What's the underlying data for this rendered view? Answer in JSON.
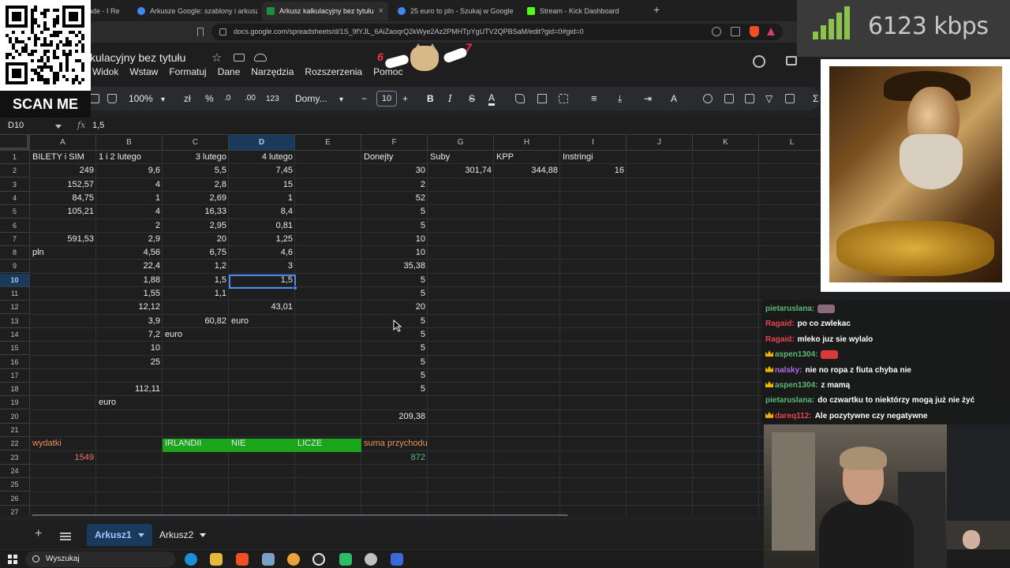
{
  "browser": {
    "tabs": [
      {
        "label": "ade - I Re",
        "favicon": "#d93025"
      },
      {
        "label": "Arkusze Google: szablony i arkusze i",
        "favicon": "#4285f4"
      },
      {
        "label": "Arkusz kalkulacyjny bez tytułu - G",
        "favicon": "#1e8e3e"
      },
      {
        "label": "25 euro to pln - Szukaj w Google",
        "favicon": "#4285f4"
      },
      {
        "label": "Stream - Kick Dashboard",
        "favicon": "#53fc18"
      }
    ],
    "active_tab": 2,
    "new_tab_label": "+",
    "url": "docs.google.com/spreadsheets/d/1S_9fYJL_6AiZaoqrQ2kWye2Az2PMHTpYgUTV2QPBSaM/edit?gid=0#gid=0"
  },
  "sheets": {
    "title": "kulacyjny bez tytułu",
    "menu": [
      "Widok",
      "Wstaw",
      "Formatuj",
      "Dane",
      "Narzędzia",
      "Rozszerzenia",
      "Pomoc"
    ],
    "toolbar": {
      "zoom": "100%",
      "currency": "zł",
      "percent": "%",
      "dec_less": ".0",
      "dec_more": ".00",
      "number_fmt": "123",
      "font": "Domy...",
      "minus": "−",
      "font_size": "10",
      "plus": "+",
      "bold": "B",
      "italic": "I",
      "strike": "S",
      "text_color": "A",
      "sigma": "Σ"
    },
    "name_box": "D10",
    "fx_label": "fx",
    "formula": "1,5",
    "columns": [
      "A",
      "B",
      "C",
      "D",
      "E",
      "F",
      "G",
      "H",
      "I",
      "J",
      "K",
      "L"
    ],
    "selected_column": "D",
    "selected_row": 10,
    "rows": [
      "1",
      "2",
      "3",
      "4",
      "5",
      "6",
      "7",
      "8",
      "9",
      "10",
      "11",
      "12",
      "13",
      "14",
      "15",
      "16",
      "17",
      "18",
      "19",
      "20",
      "21",
      "22",
      "23",
      "24",
      "25",
      "26",
      "27"
    ],
    "cells": [
      {
        "ref": "A1",
        "v": "BILETY i SIM"
      },
      {
        "ref": "B1",
        "v": "1 i 2 lutego"
      },
      {
        "ref": "C1",
        "v": "3 lutego",
        "align": "r"
      },
      {
        "ref": "D1",
        "v": "4 lutego",
        "align": "r"
      },
      {
        "ref": "F1",
        "v": "Donejty"
      },
      {
        "ref": "G1",
        "v": "Suby"
      },
      {
        "ref": "H1",
        "v": "KPP"
      },
      {
        "ref": "I1",
        "v": "Instringi"
      },
      {
        "ref": "A2",
        "v": "249",
        "align": "r"
      },
      {
        "ref": "B2",
        "v": "9,6",
        "align": "r"
      },
      {
        "ref": "C2",
        "v": "5,5",
        "align": "r"
      },
      {
        "ref": "D2",
        "v": "7,45",
        "align": "r"
      },
      {
        "ref": "F2",
        "v": "30",
        "align": "r"
      },
      {
        "ref": "G2",
        "v": "301,74",
        "align": "r"
      },
      {
        "ref": "H2",
        "v": "344,88",
        "align": "r"
      },
      {
        "ref": "I2",
        "v": "16",
        "align": "r"
      },
      {
        "ref": "A3",
        "v": "152,57",
        "align": "r"
      },
      {
        "ref": "B3",
        "v": "4",
        "align": "r"
      },
      {
        "ref": "C3",
        "v": "2,8",
        "align": "r"
      },
      {
        "ref": "D3",
        "v": "15",
        "align": "r"
      },
      {
        "ref": "F3",
        "v": "2",
        "align": "r"
      },
      {
        "ref": "A4",
        "v": "84,75",
        "align": "r"
      },
      {
        "ref": "B4",
        "v": "1",
        "align": "r"
      },
      {
        "ref": "C4",
        "v": "2,69",
        "align": "r"
      },
      {
        "ref": "D4",
        "v": "1",
        "align": "r"
      },
      {
        "ref": "F4",
        "v": "52",
        "align": "r"
      },
      {
        "ref": "A5",
        "v": "105,21",
        "align": "r"
      },
      {
        "ref": "B5",
        "v": "4",
        "align": "r"
      },
      {
        "ref": "C5",
        "v": "16,33",
        "align": "r"
      },
      {
        "ref": "D5",
        "v": "8,4",
        "align": "r"
      },
      {
        "ref": "F5",
        "v": "5",
        "align": "r"
      },
      {
        "ref": "B6",
        "v": "2",
        "align": "r"
      },
      {
        "ref": "C6",
        "v": "2,95",
        "align": "r"
      },
      {
        "ref": "D6",
        "v": "0,81",
        "align": "r"
      },
      {
        "ref": "F6",
        "v": "5",
        "align": "r"
      },
      {
        "ref": "A7",
        "v": "591,53",
        "align": "r"
      },
      {
        "ref": "B7",
        "v": "2,9",
        "align": "r"
      },
      {
        "ref": "C7",
        "v": "20",
        "align": "r"
      },
      {
        "ref": "D7",
        "v": "1,25",
        "align": "r"
      },
      {
        "ref": "F7",
        "v": "10",
        "align": "r"
      },
      {
        "ref": "A8",
        "v": "pln"
      },
      {
        "ref": "B8",
        "v": "4,56",
        "align": "r"
      },
      {
        "ref": "C8",
        "v": "6,75",
        "align": "r"
      },
      {
        "ref": "D8",
        "v": "4,6",
        "align": "r"
      },
      {
        "ref": "F8",
        "v": "10",
        "align": "r"
      },
      {
        "ref": "B9",
        "v": "22,4",
        "align": "r"
      },
      {
        "ref": "C9",
        "v": "1,2",
        "align": "r"
      },
      {
        "ref": "D9",
        "v": "3",
        "align": "r"
      },
      {
        "ref": "F9",
        "v": "35,38",
        "align": "r"
      },
      {
        "ref": "B10",
        "v": "1,88",
        "align": "r"
      },
      {
        "ref": "C10",
        "v": "1,5",
        "align": "r"
      },
      {
        "ref": "D10",
        "v": "1,5",
        "align": "r"
      },
      {
        "ref": "F10",
        "v": "5",
        "align": "r"
      },
      {
        "ref": "B11",
        "v": "1,55",
        "align": "r"
      },
      {
        "ref": "C11",
        "v": "1,1",
        "align": "r"
      },
      {
        "ref": "F11",
        "v": "5",
        "align": "r"
      },
      {
        "ref": "B12",
        "v": "12,12",
        "align": "r"
      },
      {
        "ref": "D12",
        "v": "43,01",
        "align": "r"
      },
      {
        "ref": "F12",
        "v": "20",
        "align": "r"
      },
      {
        "ref": "B13",
        "v": "3,9",
        "align": "r"
      },
      {
        "ref": "C13",
        "v": "60,82",
        "align": "r"
      },
      {
        "ref": "D13",
        "v": "euro"
      },
      {
        "ref": "F13",
        "v": "5",
        "align": "r"
      },
      {
        "ref": "B14",
        "v": "7,2",
        "align": "r"
      },
      {
        "ref": "C14",
        "v": "euro"
      },
      {
        "ref": "F14",
        "v": "5",
        "align": "r"
      },
      {
        "ref": "B15",
        "v": "10",
        "align": "r"
      },
      {
        "ref": "F15",
        "v": "5",
        "align": "r"
      },
      {
        "ref": "B16",
        "v": "25",
        "align": "r"
      },
      {
        "ref": "F16",
        "v": "5",
        "align": "r"
      },
      {
        "ref": "F17",
        "v": "5",
        "align": "r"
      },
      {
        "ref": "B18",
        "v": "112,11",
        "align": "r"
      },
      {
        "ref": "F18",
        "v": "5",
        "align": "r"
      },
      {
        "ref": "B19",
        "v": "euro"
      },
      {
        "ref": "F20",
        "v": "209,38",
        "align": "r"
      },
      {
        "ref": "A22",
        "v": "wydatki",
        "style": "orange"
      },
      {
        "ref": "C22",
        "v": "IRLANDII"
      },
      {
        "ref": "D22",
        "v": "NIE"
      },
      {
        "ref": "E22",
        "v": "LICZE"
      },
      {
        "ref": "F22",
        "v": "suma przychodu",
        "style": "orange"
      },
      {
        "ref": "A23",
        "v": "1549",
        "align": "r",
        "style": "red"
      },
      {
        "ref": "F23",
        "v": "872",
        "align": "r",
        "style": "green"
      }
    ],
    "sheet_tabs": [
      "Arkusz1",
      "Arkusz2"
    ],
    "active_sheet": 0
  },
  "taskbar": {
    "search_label": "Wyszukaj"
  },
  "overlay": {
    "scan_me": "SCAN ME",
    "bitrate": "6123 kbps",
    "badge_left": "6",
    "badge_right": "7"
  },
  "chat": [
    {
      "user": "pietaruslana:",
      "msg": "",
      "color": "#5bb974",
      "crown": false,
      "emote": "#8a6a78"
    },
    {
      "user": "Ragaid:",
      "msg": "po co zwlekac",
      "color": "#e8444f",
      "crown": false
    },
    {
      "user": "Ragaid:",
      "msg": "mleko juz sie wylalo",
      "color": "#e8444f",
      "crown": false
    },
    {
      "user": "aspen1304:",
      "msg": "",
      "color": "#5bb974",
      "crown": true,
      "emote": "#d83a3a"
    },
    {
      "user": "nalsky:",
      "msg": "nie no ropa z fiuta chyba nie",
      "color": "#b06ee8",
      "crown": true
    },
    {
      "user": "aspen1304:",
      "msg": "z mamą",
      "color": "#5bb974",
      "crown": true
    },
    {
      "user": "pietaruslana:",
      "msg": "do czwartku to niektórzy mogą już nie żyć",
      "color": "#5bb974",
      "crown": false
    },
    {
      "user": "dareq112:",
      "msg": "Ale pozytywne czy negatywne",
      "color": "#e8444f",
      "crown": true
    }
  ]
}
